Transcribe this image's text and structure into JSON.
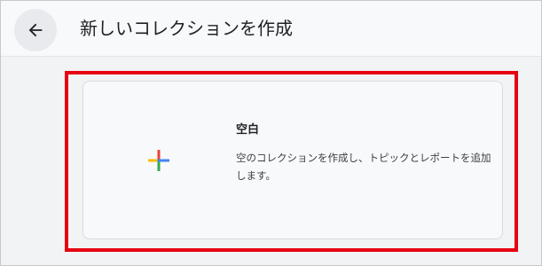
{
  "header": {
    "back_icon": "arrow-left-icon",
    "title": "新しいコレクションを作成"
  },
  "blank_card": {
    "icon": "plus-icon",
    "icon_colors": {
      "top": "#ea4335",
      "right": "#4285f4",
      "bottom": "#34a853",
      "left": "#fbbc04"
    },
    "title": "空白",
    "description": "空のコレクションを作成し、トピックとレポートを追加します。"
  },
  "highlight_color": "#e60012"
}
